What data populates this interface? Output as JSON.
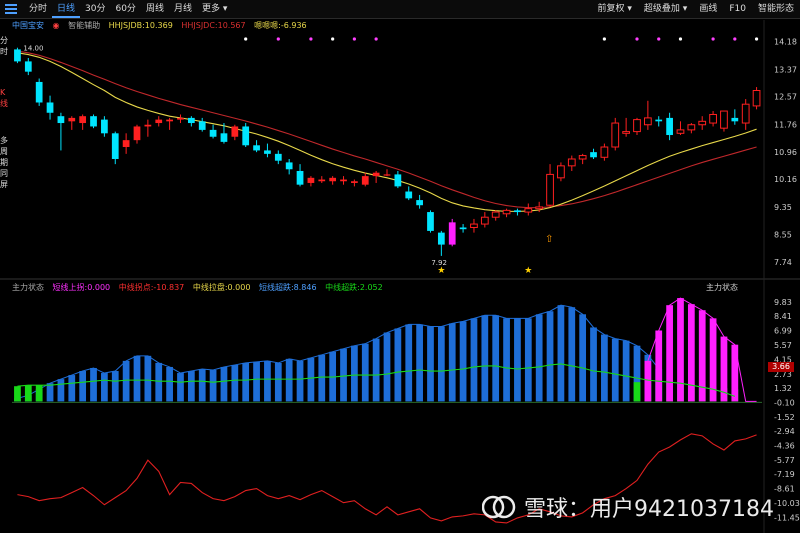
{
  "toolbar": {
    "tabs": [
      "分时",
      "日线",
      "30分",
      "60分",
      "周线",
      "月线",
      "更多"
    ],
    "active_tab": "日线",
    "right_tools": [
      "前复权",
      "超级叠加",
      "画线",
      "F10",
      "智能形态"
    ]
  },
  "side_label": [
    "分时",
    "K线",
    "多周期同屏"
  ],
  "panel1_legend": {
    "stock": "中国宝安",
    "tool": "智能辅助",
    "hhjs_b": "HHJSJDB:10.369",
    "hhjs_c": "HHJSJDC:10.567",
    "warning": "嗯嗯嗯:-6.936"
  },
  "panel2_legend": {
    "title": "主力状态",
    "items": [
      "短线上拐:0.000",
      "中线拐点:-10.837",
      "中线拉盘:0.000",
      "短线超跌:8.846",
      "中线超跌:2.052"
    ],
    "title_right": "主力状态"
  },
  "price_labels": {
    "high": "14.00",
    "low": "7.92"
  },
  "vol_value": "3.66",
  "watermark": "雪球：用户9421037184",
  "colors": {
    "up": "#ff2020",
    "down": "#00e5ff",
    "ma_yellow": "#e8d84a",
    "ma_red": "#c0282b",
    "vol_blue": "#1e6ed8",
    "vol_magenta": "#ff20ff",
    "vol_green": "#18d818",
    "line_red": "#e02020"
  },
  "chart_data": [
    {
      "type": "candlestick",
      "y_axis_ticks": [
        14.18,
        13.37,
        12.57,
        11.76,
        10.96,
        10.16,
        9.35,
        8.55,
        7.74
      ],
      "ylim": [
        7.45,
        14.4
      ],
      "candles": [
        {
          "o": 13.95,
          "h": 14.0,
          "l": 13.55,
          "c": 13.6
        },
        {
          "o": 13.6,
          "h": 13.7,
          "l": 13.2,
          "c": 13.3
        },
        {
          "o": 13.0,
          "h": 13.1,
          "l": 12.3,
          "c": 12.4
        },
        {
          "o": 12.4,
          "h": 12.6,
          "l": 11.9,
          "c": 12.1
        },
        {
          "o": 12.0,
          "h": 12.1,
          "l": 11.0,
          "c": 11.8
        },
        {
          "o": 11.85,
          "h": 12.0,
          "l": 11.6,
          "c": 11.95
        },
        {
          "o": 11.8,
          "h": 12.05,
          "l": 11.6,
          "c": 12.0
        },
        {
          "o": 12.0,
          "h": 12.05,
          "l": 11.65,
          "c": 11.7
        },
        {
          "o": 11.9,
          "h": 12.0,
          "l": 11.4,
          "c": 11.5
        },
        {
          "o": 11.5,
          "h": 11.55,
          "l": 10.6,
          "c": 10.75
        },
        {
          "o": 11.1,
          "h": 11.5,
          "l": 10.9,
          "c": 11.3
        },
        {
          "o": 11.3,
          "h": 11.75,
          "l": 11.2,
          "c": 11.7
        },
        {
          "o": 11.7,
          "h": 11.9,
          "l": 11.4,
          "c": 11.75
        },
        {
          "o": 11.8,
          "h": 12.0,
          "l": 11.7,
          "c": 11.9
        },
        {
          "o": 11.85,
          "h": 11.95,
          "l": 11.6,
          "c": 11.9
        },
        {
          "o": 11.9,
          "h": 12.05,
          "l": 11.8,
          "c": 11.95
        },
        {
          "o": 11.95,
          "h": 12.0,
          "l": 11.7,
          "c": 11.8
        },
        {
          "o": 11.85,
          "h": 11.95,
          "l": 11.55,
          "c": 11.6
        },
        {
          "o": 11.6,
          "h": 11.75,
          "l": 11.35,
          "c": 11.4
        },
        {
          "o": 11.5,
          "h": 11.8,
          "l": 11.2,
          "c": 11.25
        },
        {
          "o": 11.4,
          "h": 11.75,
          "l": 11.3,
          "c": 11.7
        },
        {
          "o": 11.7,
          "h": 11.8,
          "l": 11.1,
          "c": 11.15
        },
        {
          "o": 11.15,
          "h": 11.3,
          "l": 10.95,
          "c": 11.0
        },
        {
          "o": 11.0,
          "h": 11.2,
          "l": 10.8,
          "c": 10.9
        },
        {
          "o": 10.9,
          "h": 11.0,
          "l": 10.6,
          "c": 10.7
        },
        {
          "o": 10.65,
          "h": 10.75,
          "l": 10.3,
          "c": 10.45
        },
        {
          "o": 10.4,
          "h": 10.6,
          "l": 9.95,
          "c": 10.0
        },
        {
          "o": 10.05,
          "h": 10.25,
          "l": 9.95,
          "c": 10.2
        },
        {
          "o": 10.1,
          "h": 10.25,
          "l": 10.05,
          "c": 10.15
        },
        {
          "o": 10.1,
          "h": 10.25,
          "l": 10.0,
          "c": 10.2
        },
        {
          "o": 10.1,
          "h": 10.25,
          "l": 10.0,
          "c": 10.15
        },
        {
          "o": 10.05,
          "h": 10.15,
          "l": 9.95,
          "c": 10.1
        },
        {
          "o": 10.0,
          "h": 10.35,
          "l": 9.95,
          "c": 10.25
        },
        {
          "o": 10.25,
          "h": 10.4,
          "l": 10.05,
          "c": 10.35
        },
        {
          "o": 10.3,
          "h": 10.45,
          "l": 10.25,
          "c": 10.3
        },
        {
          "o": 10.3,
          "h": 10.4,
          "l": 9.9,
          "c": 9.95
        },
        {
          "o": 9.8,
          "h": 9.95,
          "l": 9.55,
          "c": 9.6
        },
        {
          "o": 9.55,
          "h": 9.7,
          "l": 9.3,
          "c": 9.4
        },
        {
          "o": 9.2,
          "h": 9.25,
          "l": 8.6,
          "c": 8.65
        },
        {
          "o": 8.6,
          "h": 8.65,
          "l": 7.92,
          "c": 8.25
        },
        {
          "o": 8.25,
          "h": 9.0,
          "l": 8.2,
          "c": 8.9
        },
        {
          "o": 8.75,
          "h": 8.85,
          "l": 8.6,
          "c": 8.7
        },
        {
          "o": 8.75,
          "h": 9.0,
          "l": 8.6,
          "c": 8.85
        },
        {
          "o": 8.85,
          "h": 9.2,
          "l": 8.75,
          "c": 9.05
        },
        {
          "o": 9.05,
          "h": 9.25,
          "l": 8.95,
          "c": 9.2
        },
        {
          "o": 9.15,
          "h": 9.3,
          "l": 9.05,
          "c": 9.25
        },
        {
          "o": 9.25,
          "h": 9.3,
          "l": 9.1,
          "c": 9.2
        },
        {
          "o": 9.2,
          "h": 9.45,
          "l": 9.1,
          "c": 9.3
        },
        {
          "o": 9.3,
          "h": 9.5,
          "l": 9.2,
          "c": 9.35
        },
        {
          "o": 9.4,
          "h": 10.6,
          "l": 9.35,
          "c": 10.3
        },
        {
          "o": 10.2,
          "h": 10.65,
          "l": 10.1,
          "c": 10.55
        },
        {
          "o": 10.55,
          "h": 10.85,
          "l": 10.4,
          "c": 10.75
        },
        {
          "o": 10.75,
          "h": 10.9,
          "l": 10.6,
          "c": 10.85
        },
        {
          "o": 10.95,
          "h": 11.05,
          "l": 10.75,
          "c": 10.8
        },
        {
          "o": 10.8,
          "h": 11.2,
          "l": 10.7,
          "c": 11.1
        },
        {
          "o": 11.1,
          "h": 11.95,
          "l": 11.0,
          "c": 11.8
        },
        {
          "o": 11.5,
          "h": 11.95,
          "l": 11.4,
          "c": 11.55
        },
        {
          "o": 11.55,
          "h": 11.95,
          "l": 11.45,
          "c": 11.9
        },
        {
          "o": 11.75,
          "h": 12.45,
          "l": 11.6,
          "c": 11.95
        },
        {
          "o": 11.9,
          "h": 12.0,
          "l": 11.7,
          "c": 11.85
        },
        {
          "o": 11.95,
          "h": 12.1,
          "l": 11.3,
          "c": 11.45
        },
        {
          "o": 11.5,
          "h": 11.85,
          "l": 11.45,
          "c": 11.6
        },
        {
          "o": 11.6,
          "h": 11.8,
          "l": 11.5,
          "c": 11.75
        },
        {
          "o": 11.75,
          "h": 12.0,
          "l": 11.6,
          "c": 11.85
        },
        {
          "o": 11.8,
          "h": 12.15,
          "l": 11.7,
          "c": 12.05
        },
        {
          "o": 11.65,
          "h": 12.15,
          "l": 11.55,
          "c": 12.15
        },
        {
          "o": 11.95,
          "h": 12.2,
          "l": 11.75,
          "c": 11.85
        },
        {
          "o": 11.8,
          "h": 12.5,
          "l": 11.6,
          "c": 12.35
        },
        {
          "o": 12.3,
          "h": 12.85,
          "l": 12.2,
          "c": 12.75
        }
      ],
      "ma_yellow": [
        13.85,
        13.8,
        13.72,
        13.6,
        13.45,
        13.28,
        13.1,
        12.92,
        12.75,
        12.55,
        12.4,
        12.27,
        12.17,
        12.08,
        12.0,
        11.95,
        11.9,
        11.84,
        11.78,
        11.72,
        11.64,
        11.56,
        11.48,
        11.38,
        11.27,
        11.14,
        11.0,
        10.86,
        10.73,
        10.61,
        10.51,
        10.42,
        10.34,
        10.27,
        10.2,
        10.12,
        10.02,
        9.9,
        9.76,
        9.6,
        9.47,
        9.38,
        9.32,
        9.27,
        9.24,
        9.22,
        9.22,
        9.23,
        9.26,
        9.33,
        9.43,
        9.55,
        9.68,
        9.82,
        9.96,
        10.11,
        10.26,
        10.41,
        10.56,
        10.7,
        10.83,
        10.94,
        11.04,
        11.14,
        11.23,
        11.32,
        11.41,
        11.51,
        11.62
      ],
      "ma_red": [
        13.9,
        13.85,
        13.78,
        13.68,
        13.57,
        13.45,
        13.33,
        13.2,
        13.08,
        12.95,
        12.83,
        12.72,
        12.62,
        12.52,
        12.43,
        12.34,
        12.26,
        12.18,
        12.1,
        12.02,
        11.94,
        11.86,
        11.77,
        11.68,
        11.58,
        11.48,
        11.37,
        11.26,
        11.15,
        11.04,
        10.94,
        10.84,
        10.75,
        10.65,
        10.55,
        10.45,
        10.34,
        10.22,
        10.1,
        9.97,
        9.85,
        9.74,
        9.63,
        9.53,
        9.45,
        9.39,
        9.35,
        9.33,
        9.33,
        9.35,
        9.39,
        9.44,
        9.51,
        9.59,
        9.68,
        9.78,
        9.89,
        10.0,
        10.11,
        10.22,
        10.33,
        10.44,
        10.55,
        10.65,
        10.74,
        10.83,
        10.92,
        11.01,
        11.1
      ]
    },
    {
      "type": "bar+line",
      "y_axis_ticks": [
        9.83,
        8.41,
        6.99,
        5.57,
        4.15,
        2.73,
        1.32,
        -0.1,
        -1.52,
        -2.94,
        -4.36,
        -5.77,
        -7.19,
        -8.61,
        -10.03,
        -11.45
      ],
      "ylim": [
        -12.2,
        10.8
      ],
      "bars_blue": [
        0.3,
        0.6,
        1.2,
        1.8,
        2.2,
        2.6,
        3.0,
        3.3,
        2.8,
        3.0,
        4.0,
        4.5,
        4.5,
        3.8,
        3.4,
        2.8,
        3.0,
        3.2,
        3.1,
        3.4,
        3.6,
        3.8,
        3.9,
        4.0,
        3.8,
        4.2,
        4.0,
        4.3,
        4.6,
        4.9,
        5.2,
        5.5,
        5.7,
        6.2,
        6.8,
        7.2,
        7.6,
        7.6,
        7.4,
        7.4,
        7.7,
        7.9,
        8.2,
        8.5,
        8.5,
        8.2,
        8.2,
        8.2,
        8.6,
        8.9,
        9.5,
        9.3,
        8.6,
        7.3,
        6.6,
        6.2,
        6.0,
        5.5,
        4.6,
        3.2
      ],
      "bars_magenta": {
        "start": 58,
        "values": [
          4.0,
          7.0,
          9.5,
          10.2,
          9.6,
          9.0,
          8.2,
          6.4,
          5.6,
          0,
          0,
          0,
          0,
          1.2,
          0.4,
          0,
          0,
          2.0,
          2.4,
          0,
          0,
          3.4,
          4.0,
          3.2
        ]
      },
      "green_bars": {
        "indices": [
          0,
          1,
          2,
          57,
          58,
          59,
          60,
          61,
          62,
          63,
          64,
          65,
          66
        ],
        "values": [
          1.5,
          1.6,
          1.6,
          1.9,
          2.1,
          2.0,
          1.9,
          1.8,
          1.7,
          1.5,
          1.4,
          1.3,
          1.2
        ]
      },
      "green_line": [
        1.5,
        1.6,
        1.6,
        1.6,
        1.7,
        1.8,
        1.9,
        2.0,
        2.1,
        2.0,
        2.1,
        2.1,
        2.1,
        2.0,
        2.0,
        1.9,
        2.0,
        2.0,
        1.9,
        2.0,
        2.1,
        2.1,
        2.2,
        2.2,
        2.2,
        2.2,
        2.2,
        2.3,
        2.4,
        2.4,
        2.5,
        2.6,
        2.6,
        2.6,
        2.7,
        2.9,
        3.0,
        3.1,
        3.0,
        3.0,
        3.1,
        3.2,
        3.4,
        3.5,
        3.5,
        3.3,
        3.2,
        3.3,
        3.4,
        3.6,
        3.7,
        3.5,
        3.3,
        3.0,
        2.9,
        2.7,
        2.5,
        2.3,
        2.1,
        2.0,
        1.9,
        1.8,
        1.6,
        1.4,
        1.2,
        0.9,
        0.5
      ],
      "red_line": [
        -9.2,
        -9.4,
        -9.8,
        -9.6,
        -9.5,
        -9.0,
        -8.5,
        -9.3,
        -10.2,
        -9.5,
        -8.8,
        -7.6,
        -5.8,
        -6.9,
        -9.2,
        -8.0,
        -8.1,
        -9.0,
        -9.6,
        -9.8,
        -9.4,
        -8.8,
        -8.6,
        -9.3,
        -9.6,
        -9.3,
        -9.7,
        -9.2,
        -8.8,
        -9.4,
        -10.0,
        -9.8,
        -10.6,
        -11.2,
        -10.4,
        -11.2,
        -10.9,
        -10.6,
        -11.5,
        -11.8,
        -11.4,
        -11.3,
        -11.1,
        -11.2,
        -11.9,
        -12.0,
        -11.5,
        -11.2,
        -10.6,
        -10.9,
        -11.3,
        -11.4,
        -11.0,
        -10.2,
        -9.6,
        -9.3,
        -8.6,
        -7.8,
        -6.2,
        -5.0,
        -4.5,
        -3.8,
        -3.2,
        -3.4,
        -4.2,
        -4.8,
        -3.9,
        -3.7,
        -3.3,
        -3.1
      ]
    }
  ]
}
